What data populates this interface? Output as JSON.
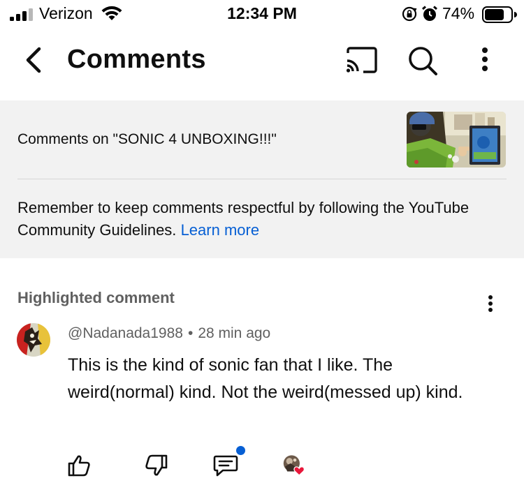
{
  "status_bar": {
    "carrier": "Verizon",
    "time": "12:34 PM",
    "battery_percent": "74%",
    "battery_level": 0.74
  },
  "header": {
    "title": "Comments",
    "icons": [
      "back-arrow-icon",
      "cast-icon",
      "search-icon",
      "more-vert-icon"
    ]
  },
  "info_panel": {
    "comments_on": "Comments on \"SONIC 4 UNBOXING!!!\"",
    "guidelines_text": "Remember to keep comments respectful by following the YouTube Community Guidelines.",
    "learn_more": "Learn more"
  },
  "highlighted": {
    "label": "Highlighted comment",
    "author": "@Nadanada1988",
    "separator": "•",
    "time_ago": "28 min ago",
    "text": "This is the kind of sonic fan that I like. The weird(normal) kind. Not the weird(messed up) kind.",
    "actions": [
      "thumbs-up-icon",
      "thumbs-down-icon",
      "reply-icon",
      "creator-heart-avatar"
    ],
    "accent_color": "#065fd4",
    "heart_color": "#e8173a"
  }
}
